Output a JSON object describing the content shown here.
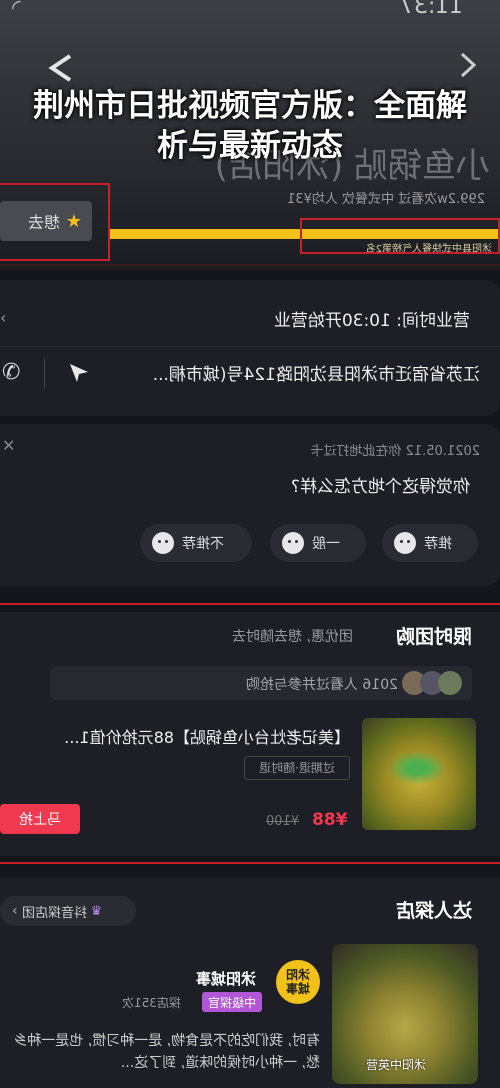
{
  "status_bar": {
    "time": "11:37"
  },
  "header": {
    "title": "荆州市日批视频官方版：全面解析与最新动态",
    "store_name_bg": "小鱼锅贴 (沭阳店)",
    "store_meta": "299.2w次看过   中式餐饮   人均¥31",
    "want_to_go": "想去",
    "ranking_tag": "沭阳县中式快餐人气榜第2名"
  },
  "info": {
    "hours": "营业时间: 10:30开始营业",
    "address": "江苏省宿迁市沭阳县沈阳路124号(城市桐..."
  },
  "feedback": {
    "date": "2021.05.12 你在此地打过卡",
    "question": "你觉得这个地方怎么样?",
    "options": [
      "推荐",
      "一般",
      "不推荐"
    ]
  },
  "deal": {
    "section_title": "限时团购",
    "section_sub": "团优惠, 想去随时去",
    "participants": "2016 人看过并参与抢购",
    "title": "【美记老灶台小鱼锅贴】88元抢价值1...",
    "tag": "过期退·随时退",
    "price": "¥88",
    "original_price": "¥100",
    "buy_label": "马上抢"
  },
  "explore": {
    "section_title": "达人探店",
    "tag": "抖音探店团",
    "author_name": "沭阳城事",
    "badge": "中级探官",
    "stat": "探店351次",
    "avatar_text": "沭阳城事",
    "review": "有时, 我们吃的不是食物, 是一种习惯, 也是一种乡愁, 一种小时候的味道, 到了这...",
    "thumb_caption": "沭阳中英营"
  },
  "colors": {
    "accent_red": "#f0384e",
    "highlight_yellow": "#f2c21b",
    "badge_purple": "#b056d6",
    "background": "#15161b"
  }
}
